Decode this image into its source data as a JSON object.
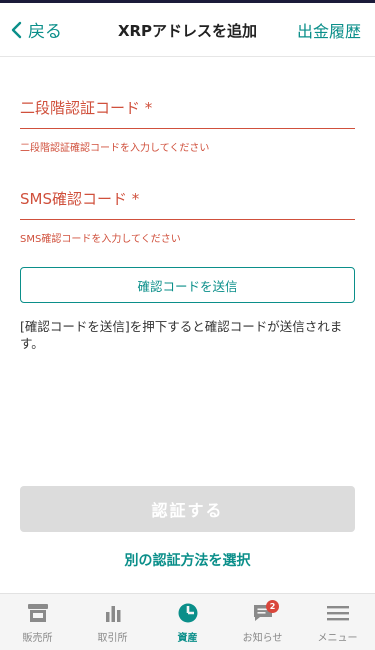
{
  "header": {
    "back_label": "戻る",
    "title": "XRPアドレスを追加",
    "history_label": "出金履歴"
  },
  "form": {
    "two_factor": {
      "label": "二段階認証コード *",
      "error": "二段階認証確認コードを入力してください"
    },
    "sms": {
      "label": "SMS確認コード *",
      "error": "SMS確認コードを入力してください"
    },
    "send_code_label": "確認コードを送信",
    "note": "[確認コードを送信]を押下すると確認コードが送信されます。",
    "submit_label": "認証する",
    "alt_method_label": "別の認証方法を選択"
  },
  "tabs": [
    {
      "label": "販売所",
      "icon": "store-icon"
    },
    {
      "label": "取引所",
      "icon": "bar-chart-icon"
    },
    {
      "label": "資産",
      "icon": "pie-chart-icon",
      "active": true
    },
    {
      "label": "お知らせ",
      "icon": "message-icon",
      "badge": "2"
    },
    {
      "label": "メニュー",
      "icon": "menu-icon"
    }
  ],
  "colors": {
    "accent": "#0b8f8a",
    "error": "#d0503c",
    "disabled": "#dcdcdc",
    "badge": "#d9463b"
  }
}
